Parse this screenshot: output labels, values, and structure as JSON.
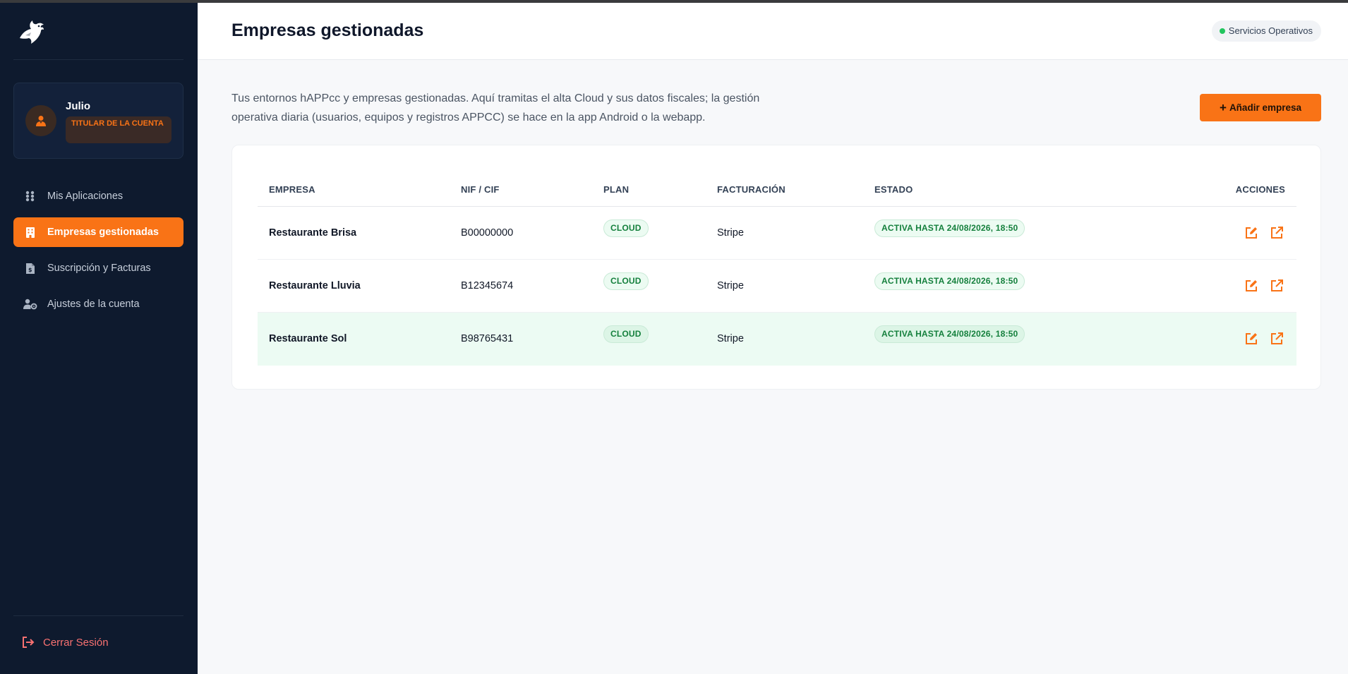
{
  "colors": {
    "sidebar_bg": "#0e1a2e",
    "accent": "#f97316",
    "status_green": "#22c55e",
    "badge_green": "#15803d",
    "highlight_row": "#ecfbf3",
    "logout_red": "#f87171"
  },
  "sidebar": {
    "logo_icon": "eagle-logo-icon",
    "profile": {
      "name": "Julio",
      "role": "TITULAR DE LA CUENTA",
      "avatar_icon": "user-icon"
    },
    "items": [
      {
        "label": "Mis Aplicaciones",
        "icon": "grid-icon",
        "active": false
      },
      {
        "label": "Empresas gestionadas",
        "icon": "building-icon",
        "active": true
      },
      {
        "label": "Suscripción y Facturas",
        "icon": "invoice-icon",
        "active": false
      },
      {
        "label": "Ajustes de la cuenta",
        "icon": "user-cog-icon",
        "active": false
      }
    ],
    "logout": {
      "label": "Cerrar Sesión",
      "icon": "logout-icon"
    }
  },
  "header": {
    "title": "Empresas gestionadas",
    "status": "Servicios Operativos"
  },
  "main": {
    "intro": "Tus entornos hAPPcc y empresas gestionadas. Aquí tramitas el alta Cloud y sus datos fiscales; la gestión operativa diaria (usuarios, equipos y registros APPCC) se hace en la app Android o la webapp.",
    "add_button": "Añadir empresa",
    "table": {
      "headers": {
        "empresa": "EMPRESA",
        "nif": "NIF / CIF",
        "plan": "PLAN",
        "facturacion": "FACTURACIÓN",
        "estado": "ESTADO",
        "acciones": "ACCIONES"
      },
      "rows": [
        {
          "empresa": "Restaurante Brisa",
          "nif": "B00000000",
          "plan": "CLOUD",
          "facturacion": "Stripe",
          "estado": "ACTIVA HASTA 24/08/2026, 18:50",
          "highlighted": false
        },
        {
          "empresa": "Restaurante Lluvia",
          "nif": "B12345674",
          "plan": "CLOUD",
          "facturacion": "Stripe",
          "estado": "ACTIVA HASTA 24/08/2026, 18:50",
          "highlighted": false
        },
        {
          "empresa": "Restaurante Sol",
          "nif": "B98765431",
          "plan": "CLOUD",
          "facturacion": "Stripe",
          "estado": "ACTIVA HASTA 24/08/2026, 18:50",
          "highlighted": true
        }
      ],
      "action_icons": [
        "edit-icon",
        "external-link-icon"
      ]
    }
  }
}
